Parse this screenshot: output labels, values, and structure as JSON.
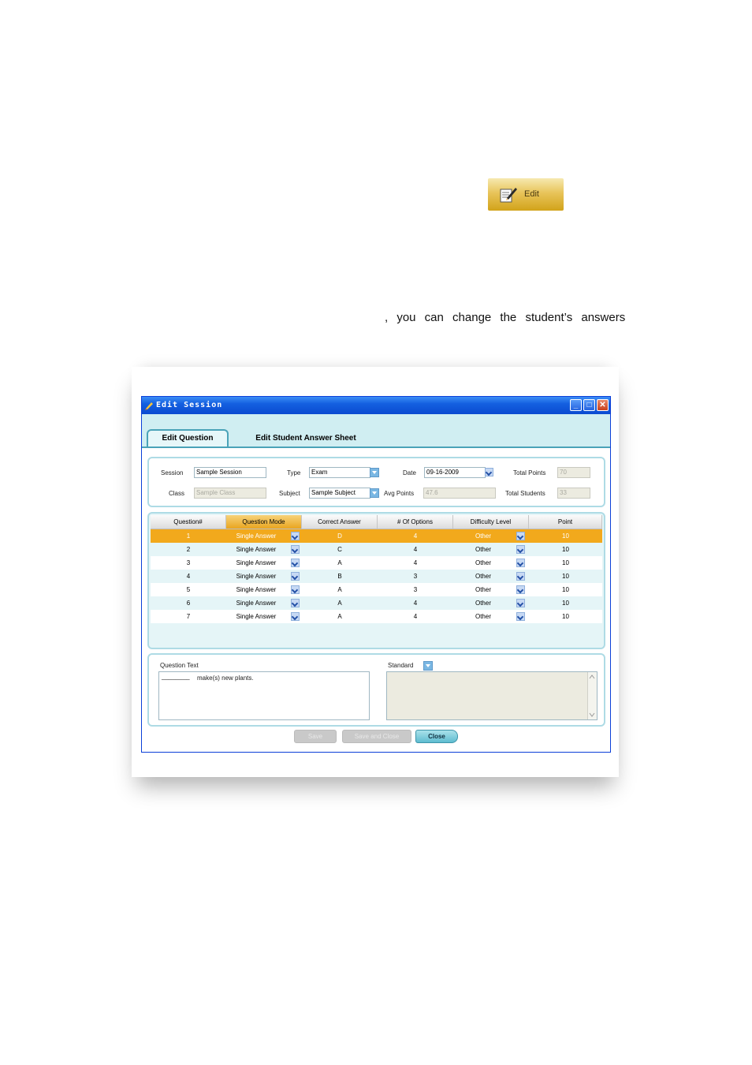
{
  "doc": {
    "edit_button_label": "Edit",
    "paragraph_fragment": ", you can change the student’s answers"
  },
  "window": {
    "title": "Edit Session",
    "tabs": [
      {
        "label": "Edit Question",
        "active": true
      },
      {
        "label": "Edit Student Answer Sheet",
        "active": false
      }
    ]
  },
  "form": {
    "session_label": "Session",
    "session_value": "Sample Session",
    "type_label": "Type",
    "type_value": "Exam",
    "date_label": "Date",
    "date_value": "09-16-2009",
    "total_points_label": "Total Points",
    "total_points_value": "70",
    "class_label": "Class",
    "class_value": "Sample Class",
    "subject_label": "Subject",
    "subject_value": "Sample Subject",
    "avg_points_label": "Avg Points",
    "avg_points_value": "47.6",
    "total_students_label": "Total Students",
    "total_students_value": "33"
  },
  "table": {
    "columns": [
      "Question#",
      "Question Mode",
      "Correct Answer",
      "# Of Options",
      "Difficulty Level",
      "Point"
    ],
    "rows": [
      [
        "1",
        "Single Answer",
        "D",
        "4",
        "Other",
        "10"
      ],
      [
        "2",
        "Single Answer",
        "C",
        "4",
        "Other",
        "10"
      ],
      [
        "3",
        "Single Answer",
        "A",
        "4",
        "Other",
        "10"
      ],
      [
        "4",
        "Single Answer",
        "B",
        "3",
        "Other",
        "10"
      ],
      [
        "5",
        "Single Answer",
        "A",
        "3",
        "Other",
        "10"
      ],
      [
        "6",
        "Single Answer",
        "A",
        "4",
        "Other",
        "10"
      ],
      [
        "7",
        "Single Answer",
        "A",
        "4",
        "Other",
        "10"
      ]
    ],
    "selected_row": 0
  },
  "question_text": {
    "label": "Question Text",
    "blank": "________",
    "value": "make(s) new plants."
  },
  "standard": {
    "label": "Standard"
  },
  "buttons": {
    "save": "Save",
    "save_close": "Save and Close",
    "close": "Close"
  },
  "colors": {
    "titlebar": "#0a4ad1",
    "selection": "#f2a91c",
    "tab_border": "#4aa3b8"
  }
}
